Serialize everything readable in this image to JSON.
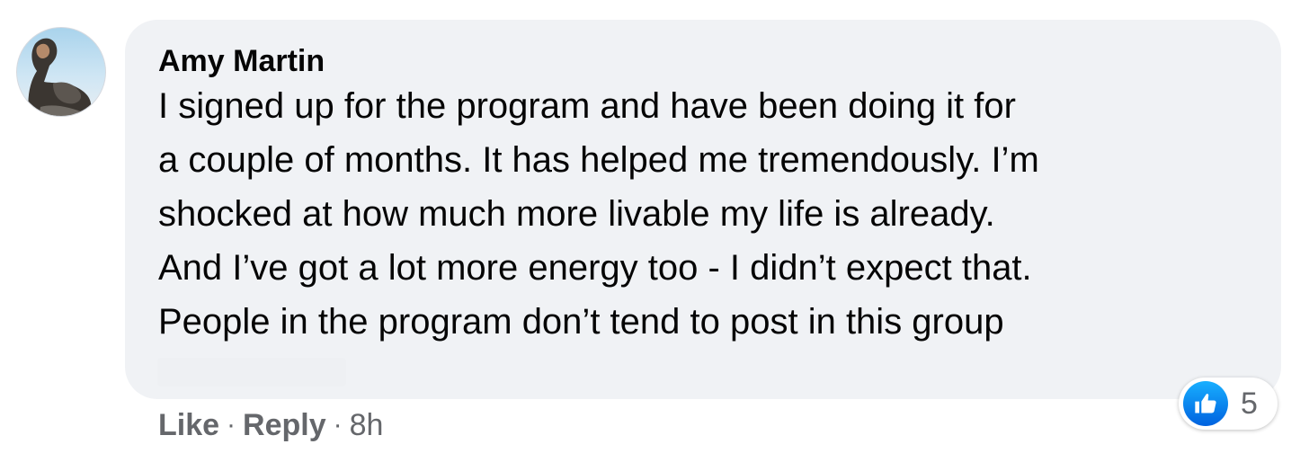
{
  "comment": {
    "author": "Amy Martin",
    "text": "I signed up for the program and have been doing it for\na couple of months. It has helped me tremendously. I’m\nshocked at how much more livable my life is already.\nAnd I’ve got a lot more energy too - I didn’t expect that.\nPeople in the program don’t tend to post in this group",
    "avatar_icon": "profile-photo",
    "reactions": {
      "icon": "thumbs-up-icon",
      "count": "5",
      "color": "#1877f2"
    },
    "actions": {
      "like": "Like",
      "reply": "Reply",
      "separator": "·",
      "timestamp": "8h"
    }
  },
  "colors": {
    "bubble_background": "#f0f2f5",
    "text": "#050505",
    "secondary_text": "#65676b"
  }
}
